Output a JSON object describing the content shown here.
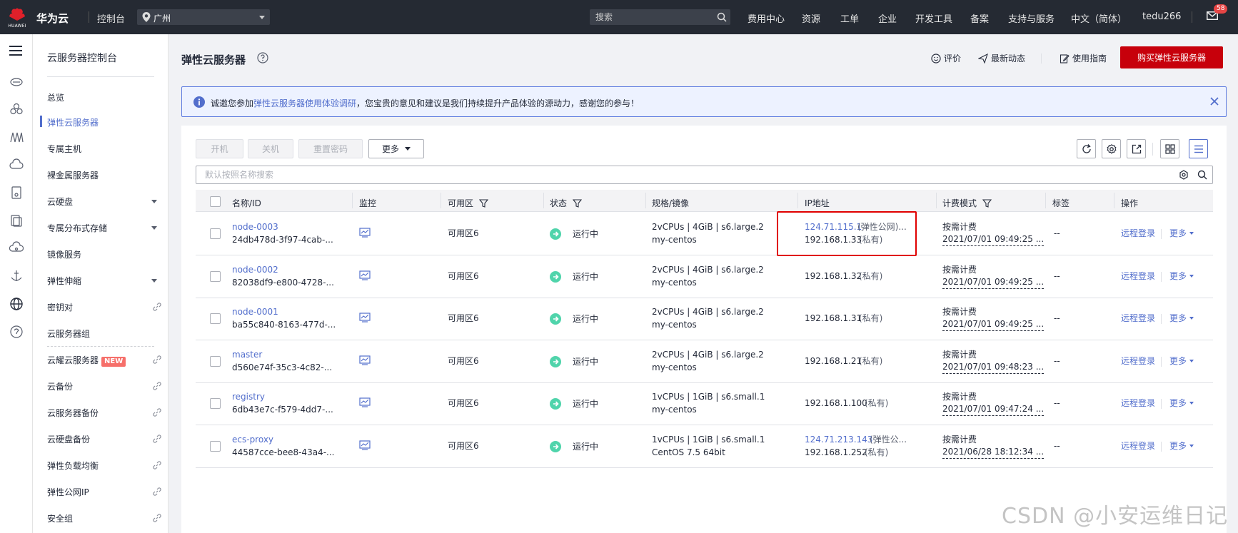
{
  "topbar": {
    "logo_text": "HUAWEI",
    "brand": "华为云",
    "console": "控制台",
    "region": "广州",
    "search_placeholder": "搜索",
    "nav": [
      "费用中心",
      "资源",
      "工单",
      "企业",
      "开发工具",
      "备案",
      "支持与服务",
      "中文（简体）",
      "tedu266"
    ],
    "mail_badge": "58"
  },
  "sidebar": {
    "title": "云服务器控制台",
    "items": [
      {
        "label": "总览"
      },
      {
        "label": "弹性云服务器",
        "active": true
      },
      {
        "label": "专属主机"
      },
      {
        "label": "裸金属服务器"
      },
      {
        "label": "云硬盘",
        "expandable": true
      },
      {
        "label": "专属分布式存储",
        "expandable": true
      },
      {
        "label": "镜像服务"
      },
      {
        "label": "弹性伸缩",
        "expandable": true
      },
      {
        "label": "密钥对",
        "external": true
      },
      {
        "label": "云服务器组"
      },
      {
        "label": "云耀云服务器",
        "tag": "NEW",
        "external": true
      },
      {
        "label": "云备份",
        "external": true
      },
      {
        "label": "云服务器备份",
        "external": true
      },
      {
        "label": "云硬盘备份",
        "external": true
      },
      {
        "label": "弹性负载均衡",
        "external": true
      },
      {
        "label": "弹性公网IP",
        "external": true
      },
      {
        "label": "安全组",
        "external": true
      }
    ]
  },
  "header": {
    "title": "弹性云服务器",
    "rate": "评价",
    "news": "最新动态",
    "guide": "使用指南",
    "buy": "购买弹性云服务器"
  },
  "notice": {
    "prefix": "诚邀您参加",
    "link": "弹性云服务器使用体验调研",
    "suffix": "，您宝贵的意见和建议是我们持续提升产品体验的源动力，感谢您的参与！"
  },
  "toolbar": {
    "start": "开机",
    "stop": "关机",
    "reset_password": "重置密码",
    "more": "更多",
    "filter_placeholder": "默认按照名称搜索"
  },
  "table": {
    "columns": [
      "名称/ID",
      "监控",
      "可用区",
      "状态",
      "规格/镜像",
      "IP地址",
      "计费模式",
      "标签",
      "操作"
    ],
    "rows": [
      {
        "name": "node-0003",
        "id": "24db478d-3f97-4cab-...",
        "zone": "可用区6",
        "status": "运行中",
        "spec": "2vCPUs | 4GiB | s6.large.2",
        "image": "my-centos",
        "ip1": "124.71.115.1",
        "ip1_note": "(弹性公网)...",
        "ip2": "192.168.1.33",
        "ip2_note": "(私有)",
        "billing": "按需计费",
        "time": "2021/07/01 09:49:25 ...",
        "tag": "--",
        "op": "远程登录",
        "more": "更多"
      },
      {
        "name": "node-0002",
        "id": "82038df9-e800-4728-...",
        "zone": "可用区6",
        "status": "运行中",
        "spec": "2vCPUs | 4GiB | s6.large.2",
        "image": "my-centos",
        "ip1": "",
        "ip1_note": "",
        "ip2": "192.168.1.32",
        "ip2_note": "(私有)",
        "billing": "按需计费",
        "time": "2021/07/01 09:49:25 ...",
        "tag": "--",
        "op": "远程登录",
        "more": "更多"
      },
      {
        "name": "node-0001",
        "id": "ba55c840-8163-477d-...",
        "zone": "可用区6",
        "status": "运行中",
        "spec": "2vCPUs | 4GiB | s6.large.2",
        "image": "my-centos",
        "ip1": "",
        "ip1_note": "",
        "ip2": "192.168.1.31",
        "ip2_note": "(私有)",
        "billing": "按需计费",
        "time": "2021/07/01 09:49:25 ...",
        "tag": "--",
        "op": "远程登录",
        "more": "更多"
      },
      {
        "name": "master",
        "id": "d560e74f-35c3-4c82-...",
        "zone": "可用区6",
        "status": "运行中",
        "spec": "2vCPUs | 4GiB | s6.large.2",
        "image": "my-centos",
        "ip1": "",
        "ip1_note": "",
        "ip2": "192.168.1.21",
        "ip2_note": "(私有)",
        "billing": "按需计费",
        "time": "2021/07/01 09:48:23 ...",
        "tag": "--",
        "op": "远程登录",
        "more": "更多"
      },
      {
        "name": "registry",
        "id": "6db43e7c-f579-4dd7-...",
        "zone": "可用区6",
        "status": "运行中",
        "spec": "1vCPUs | 1GiB | s6.small.1",
        "image": "my-centos",
        "ip1": "",
        "ip1_note": "",
        "ip2": "192.168.1.100",
        "ip2_note": "(私有)",
        "billing": "按需计费",
        "time": "2021/07/01 09:47:24 ...",
        "tag": "--",
        "op": "远程登录",
        "more": "更多"
      },
      {
        "name": "ecs-proxy",
        "id": "44587cce-bee8-43a4-...",
        "zone": "可用区6",
        "status": "运行中",
        "spec": "1vCPUs | 1GiB | s6.small.1",
        "image": "CentOS 7.5 64bit",
        "ip1": "124.71.213.143",
        "ip1_note": "(弹性公...",
        "ip2": "192.168.1.252",
        "ip2_note": "(私有)",
        "billing": "按需计费",
        "time": "2021/06/28 18:12:34 ...",
        "tag": "--",
        "op": "远程登录",
        "more": "更多"
      }
    ]
  },
  "watermark": "CSDN @小安运维日记",
  "colors": {
    "topbar": "#252a33",
    "accent": "#526ecc",
    "buy": "#c7000b",
    "running": "#50d4ab",
    "highlight": "#e00000"
  }
}
